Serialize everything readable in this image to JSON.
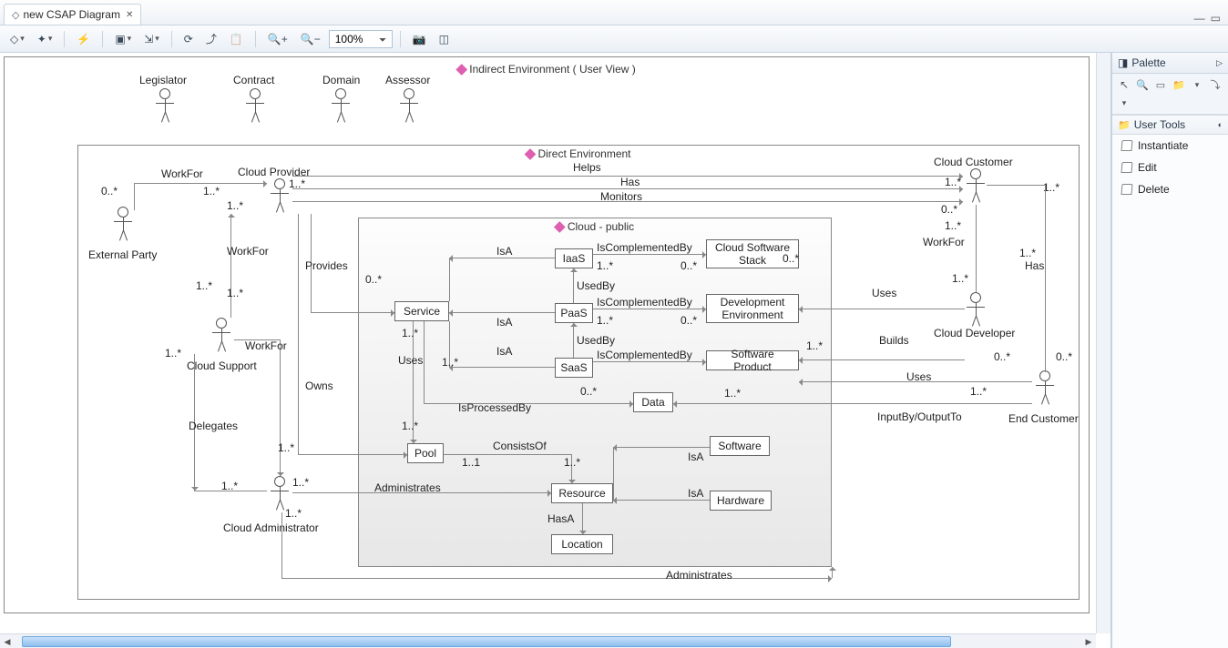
{
  "tab": {
    "title": "new CSAP Diagram"
  },
  "toolbar": {
    "zoom": "100%"
  },
  "palette": {
    "title": "Palette",
    "section": "User Tools",
    "items": [
      {
        "label": "Instantiate"
      },
      {
        "label": "Edit"
      },
      {
        "label": "Delete"
      }
    ]
  },
  "frames": {
    "indirect": "Indirect Environment ( User View )",
    "direct": "Direct Environment",
    "cloud": "Cloud - public"
  },
  "actors": {
    "legislator": "Legislator",
    "contract": "Contract",
    "domain": "Domain",
    "assessor": "Assessor",
    "externalParty": "External Party",
    "cloudProvider": "Cloud Provider",
    "cloudSupport": "Cloud Support",
    "cloudAdmin": "Cloud Administrator",
    "cloudCustomer": "Cloud Customer",
    "cloudDeveloper": "Cloud Developer",
    "endCustomer": "End Customer"
  },
  "boxes": {
    "service": "Service",
    "iaas": "IaaS",
    "paas": "PaaS",
    "saas": "SaaS",
    "css": "Cloud Software Stack",
    "devenv": "Development Environment",
    "swprod": "Software Product",
    "data": "Data",
    "pool": "Pool",
    "resource": "Resource",
    "software": "Software",
    "hardware": "Hardware",
    "location": "Location"
  },
  "rel": {
    "workFor": "WorkFor",
    "helps": "Helps",
    "has": "Has",
    "monitors": "Monitors",
    "provides": "Provides",
    "owns": "Owns",
    "delegates": "Delegates",
    "administrates": "Administrates",
    "isA": "IsA",
    "usedBy": "UsedBy",
    "isComplementedBy": "IsComplementedBy",
    "isProcessedBy": "IsProcessedBy",
    "consistsOf": "ConsistsOf",
    "hasA": "HasA",
    "uses": "Uses",
    "builds": "Builds",
    "inputOutput": "InputBy/OutputTo"
  },
  "mult": {
    "zeroMany": "0..*",
    "oneMany": "1..*",
    "oneOne": "1..1"
  },
  "chart_data": {
    "type": "diagram",
    "title": "CSAP Diagram",
    "containers": [
      {
        "id": "indirect",
        "label": "Indirect Environment ( User View )",
        "children": [
          "direct",
          "legislator",
          "contract",
          "domain",
          "assessor"
        ]
      },
      {
        "id": "direct",
        "label": "Direct Environment",
        "children": [
          "cloud",
          "externalParty",
          "cloudProvider",
          "cloudSupport",
          "cloudAdmin",
          "cloudCustomer",
          "cloudDeveloper",
          "endCustomer"
        ]
      },
      {
        "id": "cloud",
        "label": "Cloud - public",
        "children": [
          "service",
          "iaas",
          "paas",
          "saas",
          "css",
          "devenv",
          "swprod",
          "data",
          "pool",
          "resource",
          "software",
          "hardware",
          "location"
        ]
      }
    ],
    "actors": [
      "Legislator",
      "Contract",
      "Domain",
      "Assessor",
      "External Party",
      "Cloud Provider",
      "Cloud Support",
      "Cloud Administrator",
      "Cloud Customer",
      "Cloud Developer",
      "End Customer"
    ],
    "classes": [
      "Service",
      "IaaS",
      "PaaS",
      "SaaS",
      "Cloud Software Stack",
      "Development Environment",
      "Software Product",
      "Data",
      "Pool",
      "Resource",
      "Software",
      "Hardware",
      "Location"
    ],
    "relations": [
      {
        "from": "External Party",
        "to": "Cloud Provider",
        "label": "WorkFor",
        "mult_from": "0..*",
        "mult_to": "1..*"
      },
      {
        "from": "Cloud Support",
        "to": "Cloud Provider",
        "label": "WorkFor",
        "mult_from": "1..*",
        "mult_to": "1..*"
      },
      {
        "from": "Cloud Administrator",
        "to": "Cloud Support",
        "label": "WorkFor",
        "mult_from": "1..*",
        "mult_to": "1..*"
      },
      {
        "from": "Cloud Provider",
        "to": "Cloud Customer",
        "label": "Helps",
        "mult_to": "1..*"
      },
      {
        "from": "Cloud Provider",
        "to": "Cloud Customer",
        "label": "Has",
        "mult_to": "1..*"
      },
      {
        "from": "Cloud Provider",
        "to": "Cloud Customer",
        "label": "Monitors"
      },
      {
        "from": "Cloud Provider",
        "to": "Service",
        "label": "Provides",
        "mult_from": "1..*",
        "mult_to": "0..*"
      },
      {
        "from": "Cloud Provider",
        "to": "Pool",
        "label": "Owns",
        "mult_from": "1..*",
        "mult_to": "1..*"
      },
      {
        "from": "Cloud Support",
        "to": "Cloud Administrator",
        "label": "Delegates",
        "mult_from": "1..*",
        "mult_to": "1..*"
      },
      {
        "from": "Cloud Administrator",
        "to": "Resource",
        "label": "Administrates",
        "mult_from": "1..*",
        "mult_to": "1..*"
      },
      {
        "from": "Cloud Administrator",
        "to": "Cloud (public)",
        "label": "Administrates",
        "mult_from": "1..*"
      },
      {
        "from": "IaaS",
        "to": "Service",
        "label": "IsA"
      },
      {
        "from": "PaaS",
        "to": "Service",
        "label": "IsA"
      },
      {
        "from": "SaaS",
        "to": "Service",
        "label": "IsA"
      },
      {
        "from": "IaaS",
        "to": "Cloud Software Stack",
        "label": "IsComplementedBy",
        "mult_from": "1..*",
        "mult_to": "0..*"
      },
      {
        "from": "PaaS",
        "to": "Development Environment",
        "label": "IsComplementedBy",
        "mult_from": "1..*",
        "mult_to": "0..*"
      },
      {
        "from": "SaaS",
        "to": "Software Product",
        "label": "IsComplementedBy",
        "mult_from": "1..*",
        "mult_to": "0..*"
      },
      {
        "from": "PaaS",
        "to": "IaaS",
        "label": "UsedBy"
      },
      {
        "from": "SaaS",
        "to": "PaaS",
        "label": "UsedBy"
      },
      {
        "from": "Service",
        "to": "Data",
        "label": "IsProcessedBy",
        "mult_from": "1..*",
        "mult_to": "0..*"
      },
      {
        "from": "Service",
        "to": "Pool",
        "label": "Uses",
        "mult_from": "1..*",
        "mult_to": "1..*"
      },
      {
        "from": "Pool",
        "to": "Resource",
        "label": "ConsistsOf",
        "mult_from": "1..1",
        "mult_to": "1..*"
      },
      {
        "from": "Software",
        "to": "Resource",
        "label": "IsA"
      },
      {
        "from": "Hardware",
        "to": "Resource",
        "label": "IsA"
      },
      {
        "from": "Resource",
        "to": "Location",
        "label": "HasA"
      },
      {
        "from": "Cloud Customer",
        "to": "Cloud Developer",
        "label": "WorkFor",
        "mult_from": "1..*",
        "mult_to": "0..*"
      },
      {
        "from": "Cloud Customer",
        "to": "End Customer",
        "label": "Has",
        "mult_from": "1..*",
        "mult_to": "1..*"
      },
      {
        "from": "Cloud Customer",
        "to": "Service",
        "label": "Uses",
        "mult_to": "1..*"
      },
      {
        "from": "Cloud Developer",
        "to": "Software Product",
        "label": "Builds",
        "mult_from": "1..*",
        "mult_to": "1..*"
      },
      {
        "from": "Cloud Developer",
        "to": "Development Environment",
        "label": "Uses",
        "mult_to": "0..*"
      },
      {
        "from": "End Customer",
        "to": "Software Product",
        "label": "Uses",
        "mult_from": "0..*",
        "mult_to": "1..*"
      },
      {
        "from": "End Customer",
        "to": "Data",
        "label": "InputBy/OutputTo",
        "mult_to": "1..*"
      }
    ]
  }
}
